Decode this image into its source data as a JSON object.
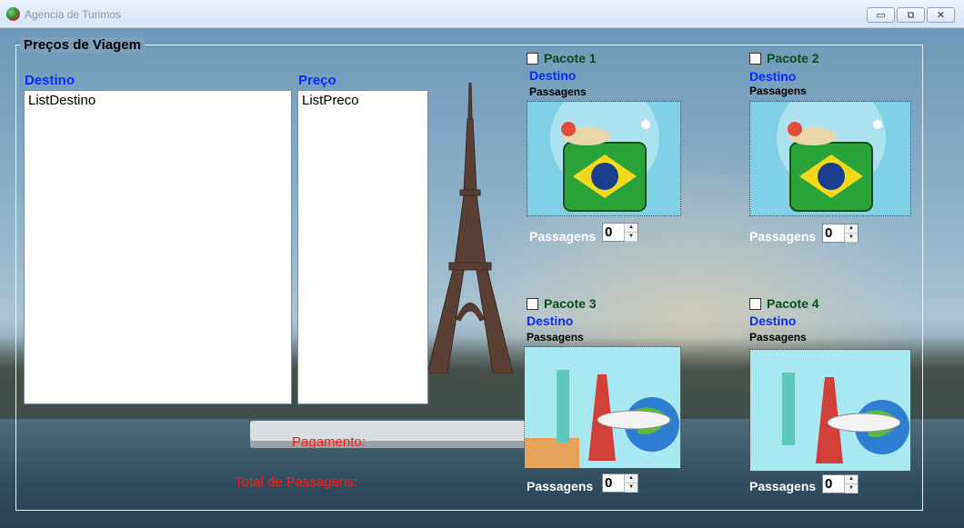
{
  "window": {
    "title": "Agencia de Turimos"
  },
  "group": {
    "title": "Preços de Viagem"
  },
  "left": {
    "destino_label": "Destino",
    "preco_label": "Preço",
    "list_destino": "ListDestino",
    "list_preco": "ListPreco",
    "pagamento_label": "Pagamento:",
    "total_label": "Total de Passagens:"
  },
  "packages": [
    {
      "title": "Pacote 1",
      "destino": "Destino",
      "passagens_caption": "Passagens",
      "passagens_label": "Passagens",
      "count": "0",
      "image": "brazil-suitcase"
    },
    {
      "title": "Pacote 2",
      "destino": "Destino",
      "passagens_caption": "Passagens",
      "passagens_label": "Passagens",
      "count": "0",
      "image": "brazil-suitcase"
    },
    {
      "title": "Pacote 3",
      "destino": "Destino",
      "passagens_caption": "Passagens",
      "passagens_label": "Passagens",
      "count": "0",
      "image": "world-travel-landmarks"
    },
    {
      "title": "Pacote 4",
      "destino": "Destino",
      "passagens_caption": "Passagens",
      "passagens_label": "Passagens",
      "count": "0",
      "image": "world-travel-landmarks"
    }
  ],
  "icons": {
    "minimize": "minimize-icon",
    "restore": "restore-icon",
    "close": "close-icon",
    "spin_up": "▲",
    "spin_down": "▼"
  }
}
